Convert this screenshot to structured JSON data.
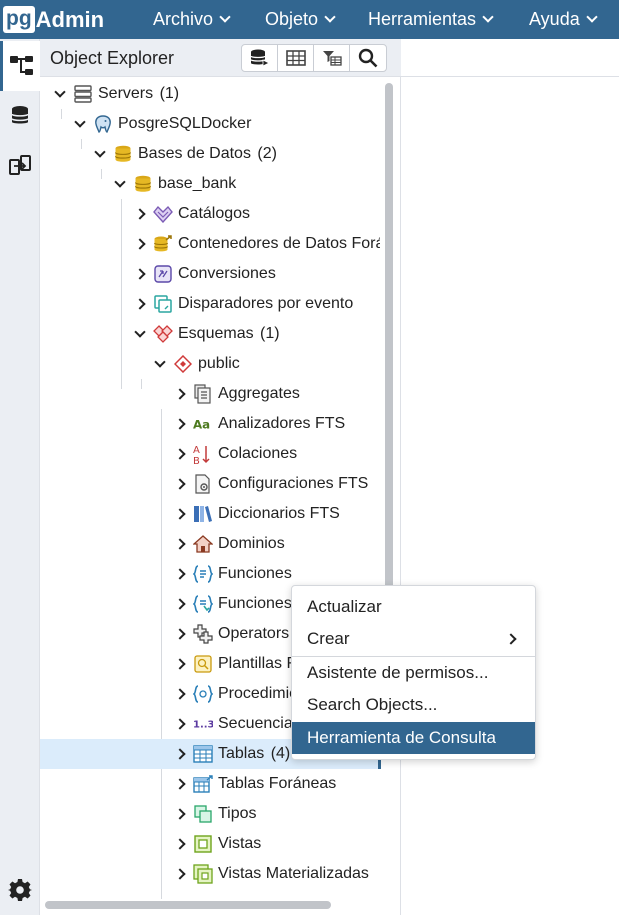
{
  "app": {
    "logo_pg": "pg",
    "logo_admin": "Admin"
  },
  "menu": {
    "archivo": "Archivo",
    "objeto": "Objeto",
    "herramientas": "Herramientas",
    "ayuda": "Ayuda"
  },
  "explorer": {
    "title": "Object Explorer",
    "toolbar_icons": [
      "query-tool-icon",
      "view-data-icon",
      "filtered-rows-icon",
      "search-icon"
    ]
  },
  "tree": {
    "servers": {
      "label": "Servers",
      "count": "(1)"
    },
    "server": {
      "label": "PosgreSQLDocker"
    },
    "databases": {
      "label": "Bases de Datos",
      "count": "(2)"
    },
    "database": {
      "label": "base_bank"
    },
    "catalogos": {
      "label": "Catálogos"
    },
    "fdw": {
      "label": "Contenedores de Datos Foráneos"
    },
    "conversiones": {
      "label": "Conversiones"
    },
    "event_triggers": {
      "label": "Disparadores por evento"
    },
    "esquemas": {
      "label": "Esquemas",
      "count": "(1)"
    },
    "public": {
      "label": "public"
    },
    "aggregates": {
      "label": "Aggregates"
    },
    "fts_parsers": {
      "label": "Analizadores FTS"
    },
    "colaciones": {
      "label": "Colaciones"
    },
    "fts_configs": {
      "label": "Configuraciones FTS"
    },
    "fts_dicts": {
      "label": "Diccionarios FTS"
    },
    "dominios": {
      "label": "Dominios"
    },
    "funciones": {
      "label": "Funciones"
    },
    "funciones_trigger": {
      "label": "Funciones de Disparador"
    },
    "operators": {
      "label": "Operators"
    },
    "plantillas": {
      "label": "Plantillas FTS"
    },
    "procedimientos": {
      "label": "Procedimientos"
    },
    "secuencias": {
      "label": "Secuencias"
    },
    "tablas": {
      "label": "Tablas",
      "count": "(4)"
    },
    "tablas_foraneas": {
      "label": "Tablas Foráneas"
    },
    "tipos": {
      "label": "Tipos"
    },
    "vistas": {
      "label": "Vistas"
    },
    "vistas_mat": {
      "label": "Vistas Materializadas"
    }
  },
  "context_menu": {
    "actualizar": "Actualizar",
    "crear": "Crear",
    "asistente": "Asistente de permisos...",
    "search": "Search Objects...",
    "consulta": "Herramienta de Consulta"
  },
  "colors": {
    "brand": "#326690",
    "selected_row": "#dbecfb"
  }
}
